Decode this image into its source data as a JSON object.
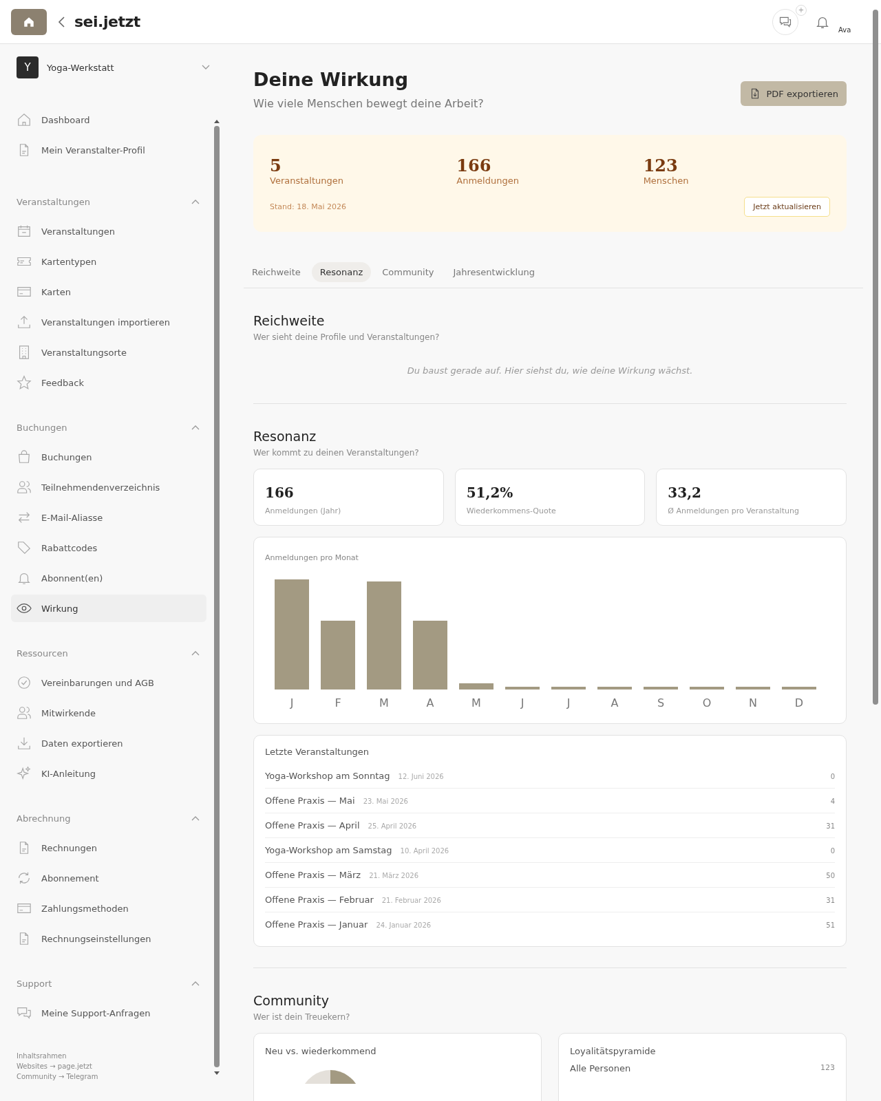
{
  "header": {
    "logo": "sei.jetzt",
    "chat_badge": "+",
    "avatar_alt": "Ava"
  },
  "sidebar": {
    "org": {
      "initial": "Y",
      "name": "Yoga-Werkstatt"
    },
    "sections": [
      {
        "items": [
          {
            "label": "Dashboard",
            "selected": false
          },
          {
            "label": "Mein Veranstalter-Profil",
            "selected": false
          }
        ]
      },
      {
        "title": "Veranstaltungen",
        "expanded": true,
        "items": [
          {
            "label": "Veranstaltungen",
            "selected": false
          },
          {
            "label": "Kartentypen",
            "selected": false
          },
          {
            "label": "Karten",
            "selected": false
          },
          {
            "label": "Veranstaltungen importieren",
            "selected": false
          },
          {
            "label": "Veranstaltungsorte",
            "selected": false
          },
          {
            "label": "Feedback",
            "selected": false
          }
        ]
      },
      {
        "title": "Buchungen",
        "expanded": true,
        "items": [
          {
            "label": "Buchungen",
            "selected": false
          },
          {
            "label": "Teilnehmendenverzeichnis",
            "selected": false
          },
          {
            "label": "E-Mail-Aliasse",
            "selected": false
          },
          {
            "label": "Rabattcodes",
            "selected": false
          },
          {
            "label": "Abonnent(en)",
            "selected": false
          },
          {
            "label": "Wirkung",
            "selected": true
          }
        ]
      },
      {
        "title": "Ressourcen",
        "expanded": true,
        "items": [
          {
            "label": "Vereinbarungen und AGB",
            "selected": false
          },
          {
            "label": "Mitwirkende",
            "selected": false
          },
          {
            "label": "Daten exportieren",
            "selected": false
          },
          {
            "label": "KI-Anleitung",
            "selected": false
          }
        ]
      },
      {
        "title": "Abrechnung",
        "expanded": true,
        "items": [
          {
            "label": "Rechnungen",
            "selected": false
          },
          {
            "label": "Abonnement",
            "selected": false
          },
          {
            "label": "Zahlungsmethoden",
            "selected": false
          },
          {
            "label": "Rechnungseinstellungen",
            "selected": false
          }
        ]
      },
      {
        "title": "Support",
        "expanded": true,
        "items": [
          {
            "label": "Meine Support-Anfragen",
            "selected": false
          }
        ]
      }
    ],
    "footer_links": [
      "Inhaltsrahmen",
      "Websites → page.jetzt",
      "Community → Telegram"
    ]
  },
  "page": {
    "title": "Deine Wirkung",
    "subtitle": "Wie viele Menschen bewegt deine Arbeit?",
    "export_button": "PDF exportieren"
  },
  "summary": {
    "stats": [
      {
        "value": "5",
        "label": "Veranstaltungen"
      },
      {
        "value": "166",
        "label": "Anmeldungen"
      },
      {
        "value": "123",
        "label": "Menschen"
      }
    ],
    "as_of": "Stand: 18. Mai 2026",
    "refresh_button": "Jetzt aktualisieren"
  },
  "tabs": [
    {
      "label": "Reichweite",
      "selected": false
    },
    {
      "label": "Resonanz",
      "selected": true
    },
    {
      "label": "Community",
      "selected": false
    },
    {
      "label": "Jahresentwicklung",
      "selected": false
    }
  ],
  "reach": {
    "title": "Reichweite",
    "subtitle": "Wer sieht deine Profile und Veranstaltungen?",
    "empty_message": "Du baust gerade auf. Hier siehst du, wie deine Wirkung wächst."
  },
  "resonance": {
    "title": "Resonanz",
    "subtitle": "Wer kommt zu deinen Veranstaltungen?",
    "kpis": [
      {
        "value": "166",
        "label": "Anmeldungen (Jahr)"
      },
      {
        "value": "51,2%",
        "label": "Wiederkommens-Quote"
      },
      {
        "value": "33,2",
        "label": "Ø Anmeldungen pro Veranstaltung"
      }
    ],
    "chart": {
      "title": "Anmeldungen pro Monat",
      "month_labels": [
        "J",
        "F",
        "M",
        "A",
        "M",
        "J",
        "J",
        "A",
        "S",
        "O",
        "N",
        "D"
      ]
    },
    "events": {
      "title": "Letzte Veranstaltungen",
      "rows": [
        {
          "name": "Yoga-Workshop am Sonntag",
          "date": "12. Juni 2026",
          "count": "0"
        },
        {
          "name": "Offene Praxis — Mai",
          "date": "23. Mai 2026",
          "count": "4"
        },
        {
          "name": "Offene Praxis — April",
          "date": "25. April 2026",
          "count": "31"
        },
        {
          "name": "Yoga-Workshop am Samstag",
          "date": "10. April 2026",
          "count": "0"
        },
        {
          "name": "Offene Praxis — März",
          "date": "21. März 2026",
          "count": "50"
        },
        {
          "name": "Offene Praxis — Februar",
          "date": "21. Februar 2026",
          "count": "31"
        },
        {
          "name": "Offene Praxis — Januar",
          "date": "24. Januar 2026",
          "count": "51"
        }
      ]
    }
  },
  "community": {
    "title": "Community",
    "subtitle": "Wer ist dein Treuekern?",
    "new_vs_returning": {
      "title": "Neu vs. wiederkommend"
    },
    "pyramid": {
      "title": "Loyalitätspyramide",
      "rows": [
        {
          "label": "Alle Personen",
          "value": "123"
        }
      ]
    }
  }
}
